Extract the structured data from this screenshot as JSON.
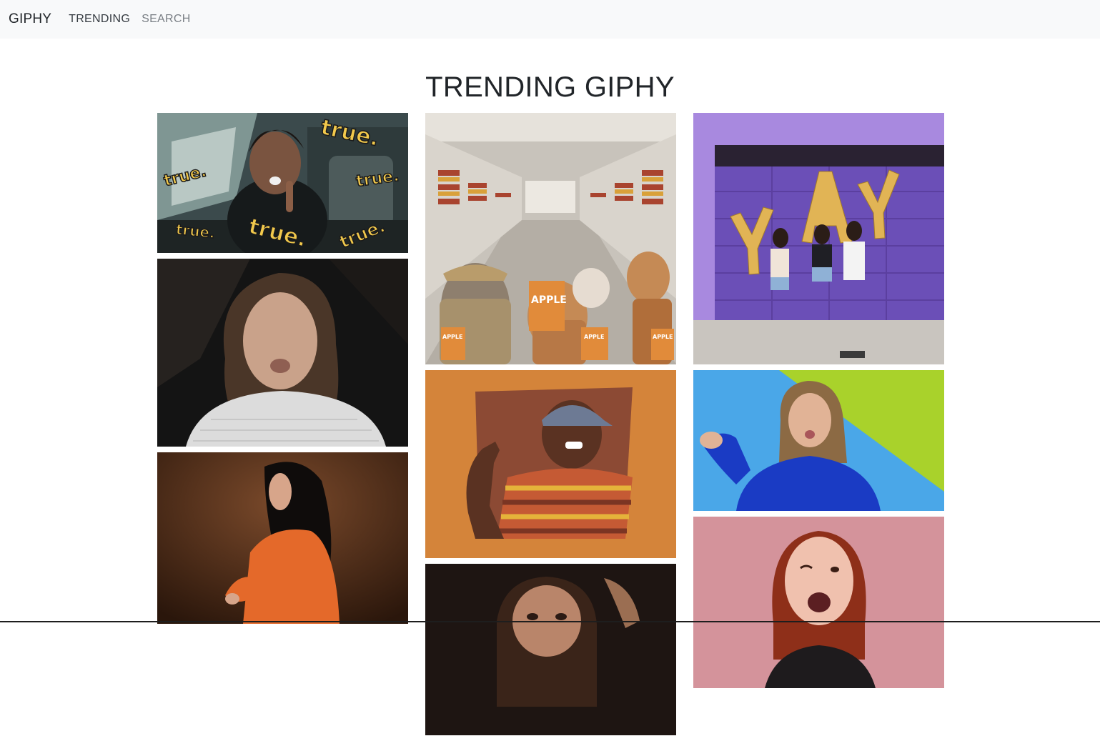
{
  "nav": {
    "brand": "GIPHY",
    "links": [
      {
        "label": "TRENDING",
        "state": "active"
      },
      {
        "label": "SEARCH",
        "state": "inactive"
      }
    ]
  },
  "main": {
    "title": "TRENDING GIPHY",
    "columns": [
      {
        "gifs": [
          {
            "subject": "man in car saying true",
            "overlay_words": [
              "true.",
              "true.",
              "true.",
              "true.",
              "true.",
              "true."
            ]
          },
          {
            "subject": "woman making disgusted face"
          },
          {
            "subject": "woman with dark hair in orange jacket"
          }
        ]
      },
      {
        "gifs": [
          {
            "subject": "animated animals in grocery store",
            "overlay_words": [
              "APPLE",
              "APPLE",
              "APPLE",
              "APPLE"
            ]
          },
          {
            "subject": "man in striped shirt and cap pointing"
          },
          {
            "subject": "woman glancing sideways in dark room"
          }
        ]
      },
      {
        "gifs": [
          {
            "subject": "women jumping with YAY balloons",
            "overlay_words": [
              "Y",
              "A",
              "Y"
            ]
          },
          {
            "subject": "woman in blue sweater pointing"
          },
          {
            "subject": "red haired woman winking"
          }
        ]
      }
    ]
  },
  "colors": {
    "navbar_bg": "#f8f9fa",
    "nav_active": "#343a40",
    "nav_muted": "#7a7f85",
    "title": "#212529"
  }
}
